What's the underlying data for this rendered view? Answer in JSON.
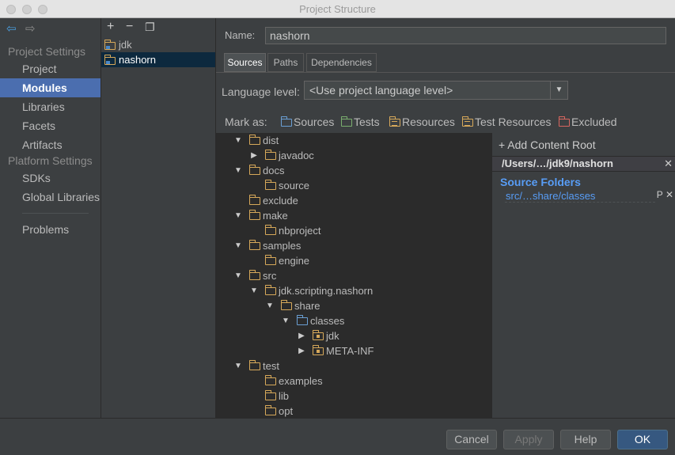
{
  "window": {
    "title": "Project Structure"
  },
  "nav": {
    "project_settings_heading": "Project Settings",
    "platform_settings_heading": "Platform Settings",
    "items": [
      {
        "label": "Project"
      },
      {
        "label": "Modules"
      },
      {
        "label": "Libraries"
      },
      {
        "label": "Facets"
      },
      {
        "label": "Artifacts"
      },
      {
        "label": "SDKs"
      },
      {
        "label": "Global Libraries"
      },
      {
        "label": "Problems"
      }
    ],
    "back_icon": "arrow-left-icon",
    "forward_icon": "arrow-right-icon"
  },
  "modules": {
    "add_label": "+",
    "remove_label": "−",
    "copy_icon": "copy-icon",
    "items": [
      {
        "label": "jdk"
      },
      {
        "label": "nashorn"
      }
    ]
  },
  "editor": {
    "name_label": "Name:",
    "name_value": "nashorn",
    "tabs": [
      {
        "label": "Sources"
      },
      {
        "label": "Paths"
      },
      {
        "label": "Dependencies"
      }
    ],
    "language_level_label": "Language level:",
    "language_level_value": "<Use project language level>",
    "mark_as_label": "Mark as:",
    "mark_as": [
      {
        "label": "Sources",
        "color": "#6a9fd4"
      },
      {
        "label": "Tests",
        "color": "#7aae6e"
      },
      {
        "label": "Resources",
        "color": "#d7a95a"
      },
      {
        "label": "Test Resources",
        "color": "#d7a95a"
      },
      {
        "label": "Excluded",
        "color": "#d8665f"
      }
    ]
  },
  "tree": [
    {
      "label": "dist",
      "toggle": "▼"
    },
    {
      "label": "javadoc",
      "toggle": "▶"
    },
    {
      "label": "docs",
      "toggle": "▼"
    },
    {
      "label": "source",
      "toggle": ""
    },
    {
      "label": "exclude",
      "toggle": ""
    },
    {
      "label": "make",
      "toggle": "▼"
    },
    {
      "label": "nbproject",
      "toggle": ""
    },
    {
      "label": "samples",
      "toggle": "▼"
    },
    {
      "label": "engine",
      "toggle": ""
    },
    {
      "label": "src",
      "toggle": "▼"
    },
    {
      "label": "jdk.scripting.nashorn",
      "toggle": "▼"
    },
    {
      "label": "share",
      "toggle": "▼"
    },
    {
      "label": "classes",
      "toggle": "▼"
    },
    {
      "label": "jdk",
      "toggle": "▶"
    },
    {
      "label": "META-INF",
      "toggle": "▶"
    },
    {
      "label": "test",
      "toggle": "▼"
    },
    {
      "label": "examples",
      "toggle": ""
    },
    {
      "label": "lib",
      "toggle": ""
    },
    {
      "label": "opt",
      "toggle": ""
    }
  ],
  "content_roots": {
    "add_label": "+ Add Content Root",
    "root_path": "/Users/…/jdk9/nashorn",
    "source_folders_heading": "Source Folders",
    "source_folder_path": "src/…share/classes",
    "close_glyph": "✕",
    "edit_glyph": "P"
  },
  "footer": {
    "cancel_label": "Cancel",
    "apply_label": "Apply",
    "help_label": "Help",
    "ok_label": "OK"
  },
  "colors": {
    "background": "#3c3f41",
    "tree_background": "#2b2b2b",
    "selection": "#4b6eaf",
    "link": "#589df6",
    "folder": "#d7a95a"
  }
}
